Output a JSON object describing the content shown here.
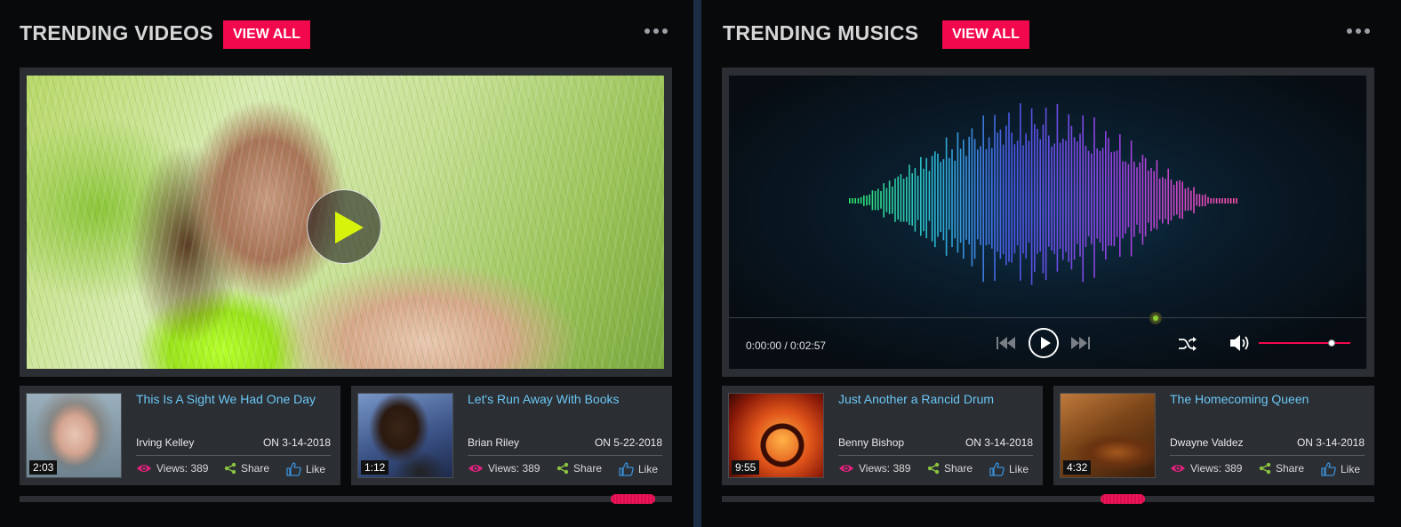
{
  "colors": {
    "accent": "#f2084d",
    "link": "#6bc7f5",
    "panel": "#2b2e33",
    "background": "#08090b",
    "play_icon": "#d7f30b"
  },
  "videos": {
    "title": "TRENDING VIDEOS",
    "view_all": "VIEW ALL",
    "more_icon": "ellipsis-icon",
    "cards": [
      {
        "title": "This Is A Sight We Had One Day",
        "author": "Irving  Kelley",
        "date": "ON 3-14-2018",
        "duration": "2:03",
        "views": "Views: 389",
        "share": "Share",
        "like": "Like"
      },
      {
        "title": "Let's Run Away  With Books",
        "author": "Brian Riley",
        "date": "ON 5-22-2018",
        "duration": "1:12",
        "views": "Views: 389",
        "share": "Share",
        "like": "Like"
      }
    ]
  },
  "music": {
    "title": "TRENDING MUSICS",
    "view_all": "VIEW ALL",
    "more_icon": "ellipsis-icon",
    "player": {
      "time": "0:00:00 / 0:02:57",
      "progress": 0.67,
      "volume": 0.8
    },
    "cards": [
      {
        "title": "Just Another a Rancid Drum",
        "author": "Benny Bishop",
        "date": "ON 3-14-2018",
        "duration": "9:55",
        "views": "Views: 389",
        "share": "Share",
        "like": "Like"
      },
      {
        "title": "The Homecoming Queen",
        "author": "Dwayne Valdez",
        "date": "ON 3-14-2018",
        "duration": "4:32",
        "views": "Views: 389",
        "share": "Share",
        "like": "Like"
      }
    ]
  }
}
